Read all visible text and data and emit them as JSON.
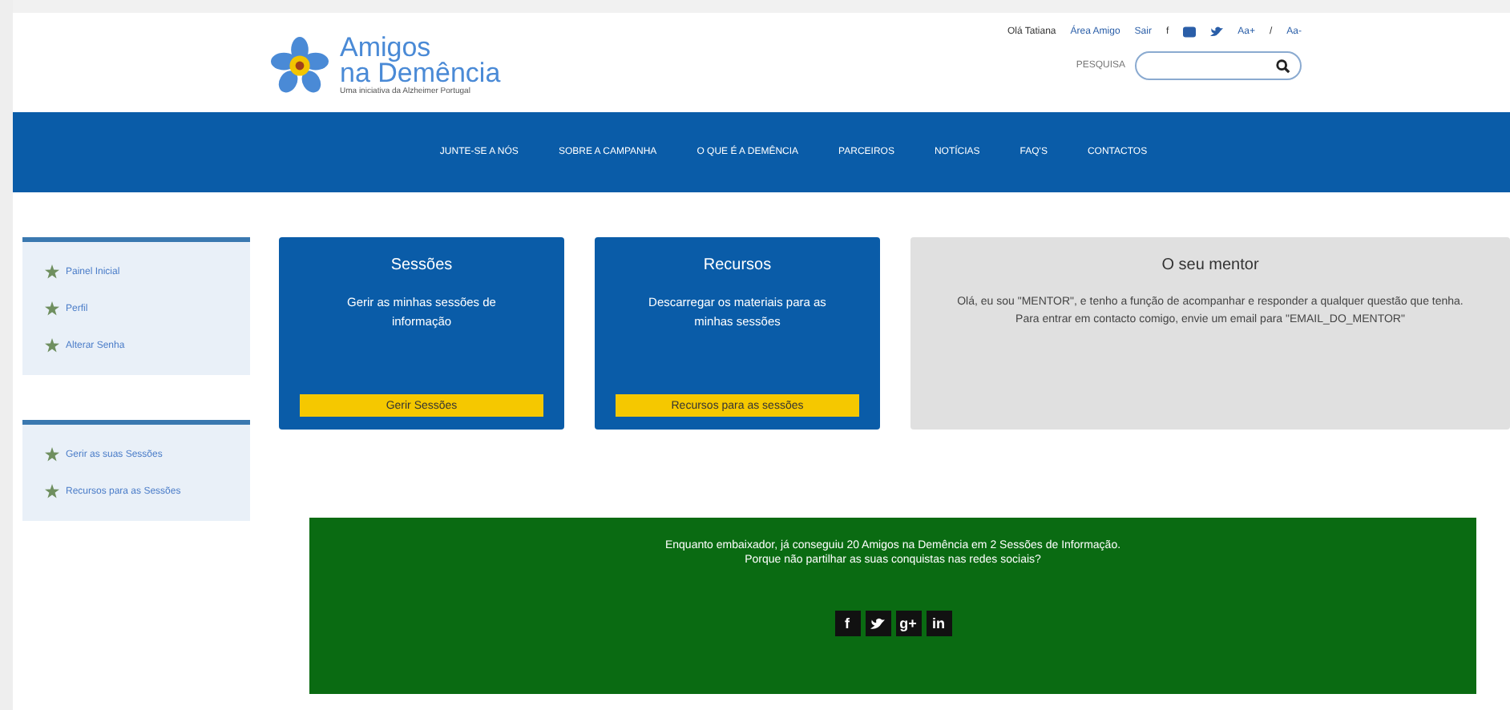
{
  "logo": {
    "line1": "Amigos",
    "line2": "na Demência",
    "tagline": "Uma iniciativa da Alzheimer Portugal"
  },
  "top_links": [
    {
      "kind": "text",
      "label": "Olá Tatiana"
    },
    {
      "kind": "link",
      "label": "Área Amigo"
    },
    {
      "kind": "link",
      "label": "Sair"
    },
    {
      "kind": "text",
      "label": "f"
    },
    {
      "kind": "youtube"
    },
    {
      "kind": "twitter"
    },
    {
      "kind": "link",
      "label": "Aa+"
    },
    {
      "kind": "text",
      "label": "/"
    },
    {
      "kind": "link",
      "label": "Aa-"
    }
  ],
  "search": {
    "label": "PESQUISA"
  },
  "nav": [
    "JUNTE-SE A NÓS",
    "SOBRE A CAMPANHA",
    "O QUE É A DEMÊNCIA",
    "PARCEIROS",
    "NOTÍCIAS",
    "FAQ'S",
    "CONTACTOS"
  ],
  "sidebar": [
    {
      "items": [
        "Painel Inicial",
        "Perfil",
        "Alterar Senha"
      ]
    },
    {
      "items": [
        "Gerir as suas Sessões",
        "Recursos para as Sessões"
      ]
    }
  ],
  "cards": [
    {
      "kind": "action",
      "title": "Sessões",
      "text": "Gerir as minhas sessões de informação",
      "button": "Gerir Sessões"
    },
    {
      "kind": "action",
      "title": "Recursos",
      "text": "Descarregar os materiais para as minhas sessões",
      "button": "Recursos para as sessões"
    },
    {
      "kind": "info",
      "title": "O seu mentor",
      "text": "Olá, eu sou \"MENTOR\", e tenho a função de acompanhar e responder a qualquer questão que tenha. Para entrar em contacto comigo, envie um email para \"EMAIL_DO_MENTOR\""
    }
  ],
  "banner": {
    "lines": [
      "Enquanto embaixador, já conseguiu 20 Amigos na Demência em 2 Sessões de Informação.",
      "Porque não partilhar as suas conquistas nas redes sociais?"
    ],
    "share": [
      {
        "kind": "text",
        "label": "f"
      },
      {
        "kind": "twitter"
      },
      {
        "kind": "text",
        "label": "g+"
      },
      {
        "kind": "text",
        "label": "in"
      }
    ]
  }
}
